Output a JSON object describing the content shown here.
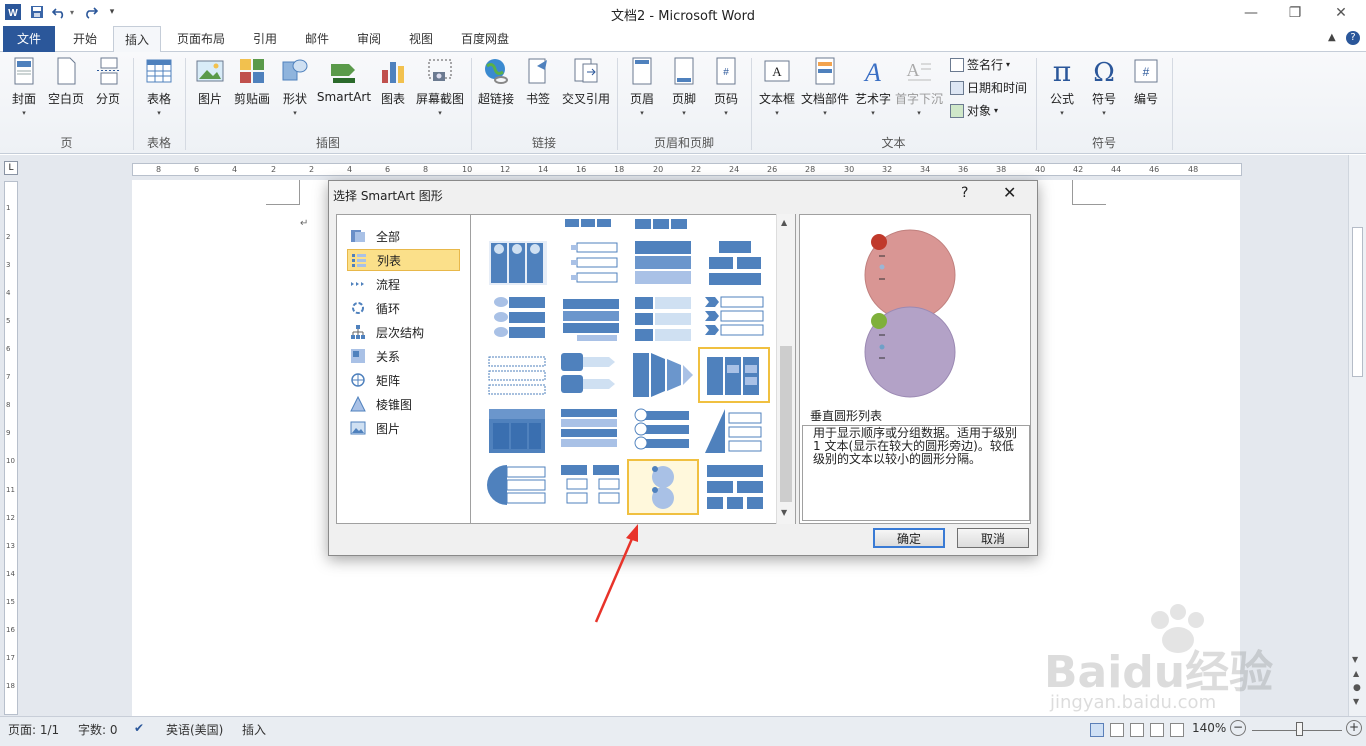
{
  "window": {
    "title": "文档2 - Microsoft Word",
    "app_icon_letter": "W"
  },
  "quick_access": [
    "save-icon",
    "undo-icon",
    "redo-icon",
    "customize-icon"
  ],
  "tabs": [
    {
      "label": "文件"
    },
    {
      "label": "开始"
    },
    {
      "label": "插入"
    },
    {
      "label": "页面布局"
    },
    {
      "label": "引用"
    },
    {
      "label": "邮件"
    },
    {
      "label": "审阅"
    },
    {
      "label": "视图"
    },
    {
      "label": "百度网盘"
    }
  ],
  "active_tab": "插入",
  "ribbon": {
    "groups": [
      {
        "label": "页"
      },
      {
        "label": "表格"
      },
      {
        "label": "插图"
      },
      {
        "label": "链接"
      },
      {
        "label": "页眉和页脚"
      },
      {
        "label": "文本"
      },
      {
        "label": "符号"
      }
    ],
    "buttons": [
      {
        "label": "封面"
      },
      {
        "label": "空白页"
      },
      {
        "label": "分页"
      },
      {
        "label": "表格"
      },
      {
        "label": "图片"
      },
      {
        "label": "剪贴画"
      },
      {
        "label": "形状"
      },
      {
        "label": "SmartArt"
      },
      {
        "label": "图表"
      },
      {
        "label": "屏幕截图"
      },
      {
        "label": "超链接"
      },
      {
        "label": "书签"
      },
      {
        "label": "交叉引用"
      },
      {
        "label": "页眉"
      },
      {
        "label": "页脚"
      },
      {
        "label": "页码"
      },
      {
        "label": "文本框"
      },
      {
        "label": "文档部件"
      },
      {
        "label": "艺术字"
      },
      {
        "label": "首字下沉"
      },
      {
        "label": "公式"
      },
      {
        "label": "符号"
      },
      {
        "label": "编号"
      }
    ],
    "small_buttons": [
      {
        "label": "签名行"
      },
      {
        "label": "日期和时间"
      },
      {
        "label": "对象"
      }
    ]
  },
  "ruler": {
    "h_ticks": [
      "8",
      "6",
      "4",
      "2",
      "2",
      "4",
      "6",
      "8",
      "10",
      "12",
      "14",
      "16",
      "18",
      "20",
      "22",
      "24",
      "26",
      "28",
      "30",
      "32",
      "34",
      "36",
      "38",
      "40",
      "42",
      "44",
      "46",
      "48"
    ],
    "v_ticks": [
      "1",
      "2",
      "3",
      "4",
      "5",
      "6",
      "7",
      "8",
      "9",
      "10",
      "11",
      "12",
      "13",
      "14",
      "15",
      "16",
      "17",
      "18"
    ]
  },
  "dialog": {
    "title": "选择 SmartArt 图形",
    "help": "?",
    "close": "✕",
    "categories": [
      {
        "label": "全部",
        "icon": "all-icon"
      },
      {
        "label": "列表",
        "icon": "list-icon"
      },
      {
        "label": "流程",
        "icon": "process-icon"
      },
      {
        "label": "循环",
        "icon": "cycle-icon"
      },
      {
        "label": "层次结构",
        "icon": "hierarchy-icon"
      },
      {
        "label": "关系",
        "icon": "relationship-icon"
      },
      {
        "label": "矩阵",
        "icon": "matrix-icon"
      },
      {
        "label": "棱锥图",
        "icon": "pyramid-icon"
      },
      {
        "label": "图片",
        "icon": "picture-icon"
      }
    ],
    "selected_category": "列表",
    "selected_layout_name": "垂直圆形列表",
    "selected_layout_description": "用于显示顺序或分组数据。适用于级别 1 文本(显示在较大的圆形旁边)。较低级别的文本以较小的圆形分隔。",
    "ok_label": "确定",
    "cancel_label": "取消"
  },
  "status": {
    "page": "页面: 1/1",
    "words": "字数: 0",
    "language": "英语(美国)",
    "mode": "插入",
    "zoom": "140%",
    "zoom_minus": "−",
    "zoom_plus": "+"
  },
  "watermark": {
    "text": "Baidu经验",
    "url": "jingyan.baidu.com"
  },
  "colors": {
    "accent": "#2b579a",
    "smartart_blue": "#4f81bd",
    "selection": "#f0c040",
    "preview_red": "#d99694",
    "preview_purple": "#b3a2c7"
  }
}
